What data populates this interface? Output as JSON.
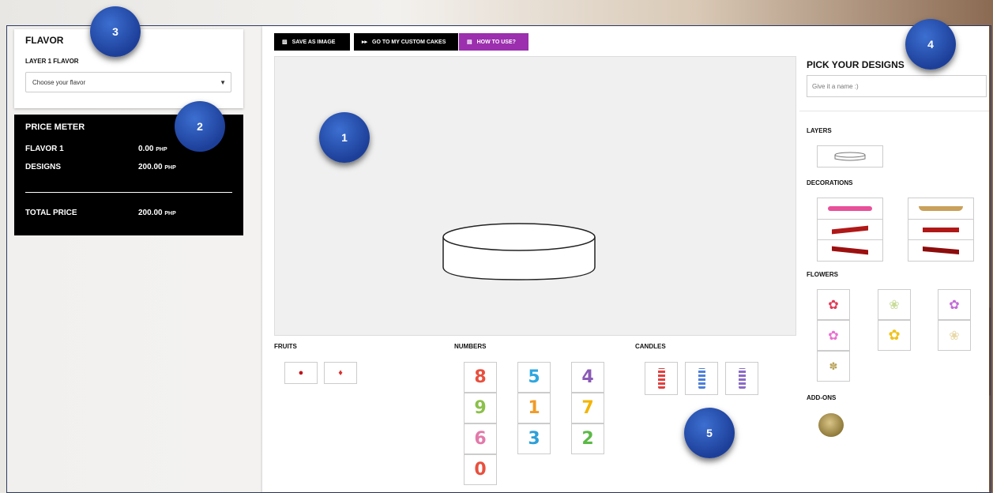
{
  "flavor": {
    "title": "FLAVOR",
    "layer_label": "LAYER 1 FLAVOR",
    "select_value": "Choose your flavor"
  },
  "price": {
    "title": "PRICE METER",
    "rows": [
      {
        "label": "FLAVOR 1",
        "value": "0.00",
        "unit": "PHP"
      },
      {
        "label": "DESIGNS",
        "value": "200.00",
        "unit": "PHP"
      }
    ],
    "total": {
      "label": "TOTAL PRICE",
      "value": "200.00",
      "unit": "PHP"
    }
  },
  "toolbar": {
    "save": "SAVE AS IMAGE",
    "goto": "GO TO MY CUSTOM CAKES",
    "howto": "HOW TO USE?"
  },
  "sections": {
    "fruits": "FRUITS",
    "numbers": "NUMBERS",
    "candles": "CANDLES"
  },
  "numbers": [
    "8",
    "5",
    "4",
    "9",
    "1",
    "7",
    "6",
    "3",
    "2",
    "0"
  ],
  "number_colors": [
    "#e8503e",
    "#2fa7e0",
    "#8a5bb6",
    "#8cc04a",
    "#f29b25",
    "#f4b400",
    "#e27aa9",
    "#2f9fd8",
    "#5bb946",
    "#e8503e"
  ],
  "designs": {
    "title": "PICK YOUR DESIGNS",
    "name_placeholder": "Give it a name :)",
    "layers": "LAYERS",
    "decorations": "DECORATIONS",
    "flowers": "FLOWERS",
    "addons": "ADD-ONS"
  },
  "badges": [
    "1",
    "2",
    "3",
    "4",
    "5"
  ]
}
